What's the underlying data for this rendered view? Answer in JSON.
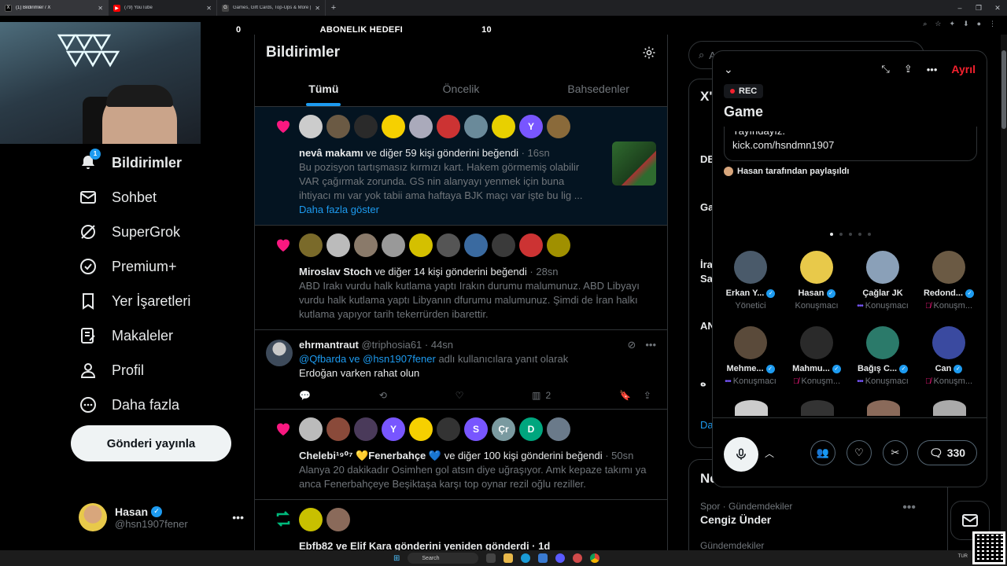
{
  "browser": {
    "tabs": [
      {
        "title": "(1) Bildirimler / X",
        "favicon": "x-icon",
        "active": true
      },
      {
        "title": "(79) YouTube",
        "favicon": "youtube-icon",
        "active": false
      },
      {
        "title": "Games, Gift Cards, Top-Ups & More | ...",
        "favicon": "g-icon",
        "active": false
      }
    ],
    "new_tab": "+"
  },
  "stream": {
    "goal_left": "0",
    "goal_label": "ABONELIK HEDEFI",
    "goal_right": "10"
  },
  "sidebar": {
    "items": [
      {
        "label": "Bildirimler",
        "icon": "bell-icon",
        "badge": "1",
        "active": true
      },
      {
        "label": "Sohbet",
        "icon": "mail-icon"
      },
      {
        "label": "SuperGrok",
        "icon": "grok-icon"
      },
      {
        "label": "Premium+",
        "icon": "verified-badge-icon"
      },
      {
        "label": "Yer İşaretleri",
        "icon": "bookmark-icon"
      },
      {
        "label": "Makaleler",
        "icon": "article-icon"
      },
      {
        "label": "Profil",
        "icon": "profile-icon"
      },
      {
        "label": "Daha fazla",
        "icon": "more-circle-icon"
      }
    ],
    "post_button": "Gönderi yayınla",
    "account": {
      "name": "Hasan",
      "handle": "@hsn1907fener"
    }
  },
  "main": {
    "title": "Bildirimler",
    "tabs": [
      "Tümü",
      "Öncelik",
      "Bahsedenler"
    ],
    "active_tab": "Tümü",
    "notifications": [
      {
        "type": "like",
        "avatars": [
          "",
          "",
          "",
          "",
          "",
          "",
          "",
          "",
          "Y",
          ""
        ],
        "actor": "nevâ makamı",
        "text": " ve diğer 59 kişi gönderini beğendi",
        "time": " · 16sn",
        "body": "Bu pozisyon tartışmasız kırmızı kart. Hakem görmemiş olabilir VAR çağırmak zorunda. GS nin alanyayı yenmek için buna ihtiyacı mı var yok tabii ama haftaya BJK maçı var işte bu lig ...",
        "show_more": "Daha fazla göster"
      },
      {
        "type": "like",
        "avatars": [
          "",
          "",
          "",
          "",
          "",
          "",
          "",
          "",
          "",
          ""
        ],
        "actor": "Miroslav Stoch",
        "text": " ve diğer 14 kişi gönderini beğendi",
        "time": " · 28sn",
        "body": "ABD Irakı vurdu halk kutlama yaptı Irakın durumu malumunuz. ABD Libyayı vurdu halk kutlama yaptı Libyanın dfurumu malumunuz. Şimdi de İran halkı kutlama yapıyor tarih tekerrürden ibarettir."
      },
      {
        "type": "reply",
        "name": "ehrmantraut",
        "handle": "@triphosia61",
        "time": " · 44sn",
        "reply_to": "@Qfbarda ve @hsn1907fener",
        "reply_suffix": " adlı kullanıcılara yanıt olarak",
        "body": "Erdoğan varken rahat olun",
        "views": "2"
      },
      {
        "type": "like",
        "avatars": [
          "",
          "",
          "",
          "Y",
          "",
          "",
          "S",
          "Çr",
          "D",
          ""
        ],
        "actor": "Chelebi¹⁹⁰⁷ 💛Fenerbahçe 💙",
        "text": " ve diğer 100 kişi gönderini beğendi",
        "time": " · 50sn",
        "body": "Alanya 20 dakikadır Osimhen gol atsın diye uğraşıyor. Amk kepaze takımı ya anca Fenerbahçeye Beşiktaşa karşı top oynar rezil oğlu reziller."
      },
      {
        "type": "repost",
        "text_line": "Ebfb82 ve Elif Kara  gönderini yeniden gönderdi · 1d"
      }
    ]
  },
  "right": {
    "search_placeholder": "A",
    "fragments": [
      "X'",
      "DE",
      "Ga",
      "İra",
      "Sa",
      "AN",
      "ه",
      "Da"
    ],
    "trend_heading": "Ne",
    "trend_category": "Spor · Gündemdekiler",
    "trend_name": "Cengiz Ünder",
    "trend_next": "Gündemdekiler"
  },
  "space": {
    "leave": "Ayrıl",
    "rec": "REC",
    "title": "Game",
    "pinned_partial": "Yayındayız.",
    "pinned_link": "kick.com/hsndmn1907",
    "shared_by": "Hasan tarafından paylaşıldı",
    "participants": [
      {
        "name": "Erkan Y...",
        "role": "Yönetici",
        "verified": true,
        "status": "none",
        "color": "#4a5a6a"
      },
      {
        "name": "Hasan",
        "role": "Konuşmacı",
        "verified": true,
        "status": "none",
        "color": "#e8c94a"
      },
      {
        "name": "Çağlar JK",
        "role": "Konuşmacı",
        "verified": false,
        "status": "speaking",
        "color": "#8aa0b8"
      },
      {
        "name": "Redond...",
        "role": "Konuşm...",
        "verified": true,
        "status": "muted",
        "color": "#6b5a44"
      },
      {
        "name": "Mehme...",
        "role": "Konuşmacı",
        "verified": true,
        "status": "speaking",
        "color": "#5a4a3a"
      },
      {
        "name": "Mahmu...",
        "role": "Konuşm...",
        "verified": true,
        "status": "muted",
        "color": "#2a2a2a"
      },
      {
        "name": "Bağış C...",
        "role": "Konuşmacı",
        "verified": true,
        "status": "speaking",
        "color": "#2b7a6a"
      },
      {
        "name": "Can",
        "role": "Konuşm...",
        "verified": true,
        "status": "muted",
        "color": "#3a4aa0"
      }
    ],
    "listener_count": "330"
  },
  "taskbar": {
    "search": "Search",
    "tray": "TUR"
  }
}
